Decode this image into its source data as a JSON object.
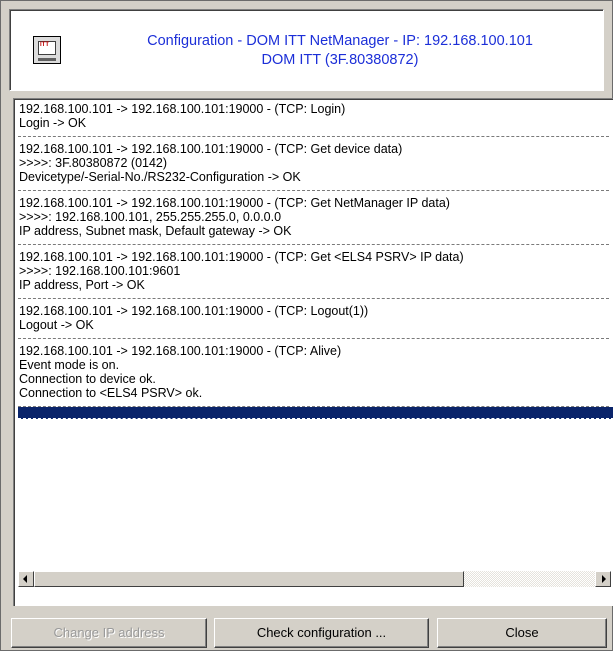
{
  "header": {
    "icon": "itt-device-icon",
    "icon_text": "ITT",
    "title_line1": "Configuration - DOM ITT NetManager - IP: 192.168.100.101",
    "title_line2": "DOM ITT (3F.80380872)",
    "title_color": "#1c2fd8"
  },
  "log": {
    "entries": [
      {
        "lines": [
          "192.168.100.101 -> 192.168.100.101:19000 - (TCP: Login)",
          "Login -> OK"
        ]
      },
      {
        "lines": [
          "192.168.100.101 -> 192.168.100.101:19000 - (TCP: Get device data)",
          ">>>>: 3F.80380872 (0142)",
          "Devicetype/-Serial-No./RS232-Configuration -> OK"
        ]
      },
      {
        "lines": [
          "192.168.100.101 -> 192.168.100.101:19000 - (TCP: Get NetManager IP data)",
          ">>>>: 192.168.100.101, 255.255.255.0, 0.0.0.0",
          "IP address, Subnet mask, Default gateway -> OK"
        ]
      },
      {
        "lines": [
          "192.168.100.101 -> 192.168.100.101:19000 - (TCP: Get <ELS4 PSRV> IP data)",
          ">>>>: 192.168.100.101:9601",
          "IP address, Port -> OK"
        ]
      },
      {
        "lines": [
          "192.168.100.101 -> 192.168.100.101:19000 - (TCP: Logout(1))",
          "Logout -> OK"
        ]
      },
      {
        "lines": [
          "192.168.100.101 -> 192.168.100.101:19000 - (TCP: Alive)",
          "Event mode is on.",
          "Connection to device ok.",
          "Connection to <ELS4 PSRV> ok."
        ]
      }
    ],
    "selection_color": "#0a246a"
  },
  "buttons": {
    "change_ip": "Change IP address",
    "check_config": "Check configuration ...",
    "close": "Close"
  }
}
